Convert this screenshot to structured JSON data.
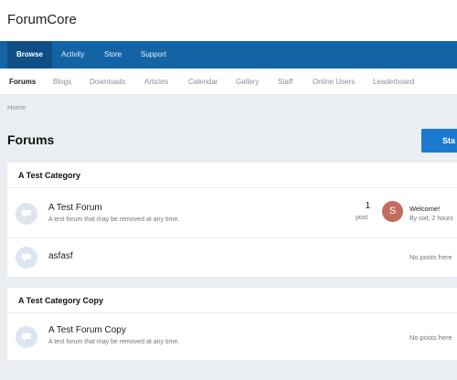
{
  "site": {
    "title": "ForumCore"
  },
  "primary_nav": [
    {
      "label": "Browse",
      "active": true
    },
    {
      "label": "Activity"
    },
    {
      "label": "Store"
    },
    {
      "label": "Support"
    }
  ],
  "secondary_nav": [
    {
      "label": "Forums",
      "active": true
    },
    {
      "label": "Blogs"
    },
    {
      "label": "Downloads"
    },
    {
      "label": "Articles"
    },
    {
      "label": "Calendar"
    },
    {
      "label": "Gallery"
    },
    {
      "label": "Staff"
    },
    {
      "label": "Online Users"
    },
    {
      "label": "Leaderboard"
    }
  ],
  "breadcrumb": "Home",
  "page": {
    "title": "Forums",
    "start_button": "Sta"
  },
  "categories": [
    {
      "title": "A Test Category",
      "forums": [
        {
          "name": "A Test Forum",
          "description": "A test forum that may be removed at any time.",
          "post_count": "1",
          "post_label": "post",
          "last_post": {
            "avatar_letter": "S",
            "title": "Welcome!",
            "meta": "By sixt, 2 hours"
          }
        },
        {
          "name": "asfasf",
          "no_posts": "No posts here"
        }
      ]
    },
    {
      "title": "A Test Category Copy",
      "forums": [
        {
          "name": "A Test Forum Copy",
          "description": "A test forum that may be removed at any time.",
          "no_posts": "No posts here"
        }
      ]
    }
  ],
  "colors": {
    "primary_nav": "#1464a5",
    "button": "#1a7ad0",
    "avatar": "#c26c5e",
    "background": "#ebeef2"
  },
  "icons": {
    "forum": "chat-bubble-icon"
  }
}
